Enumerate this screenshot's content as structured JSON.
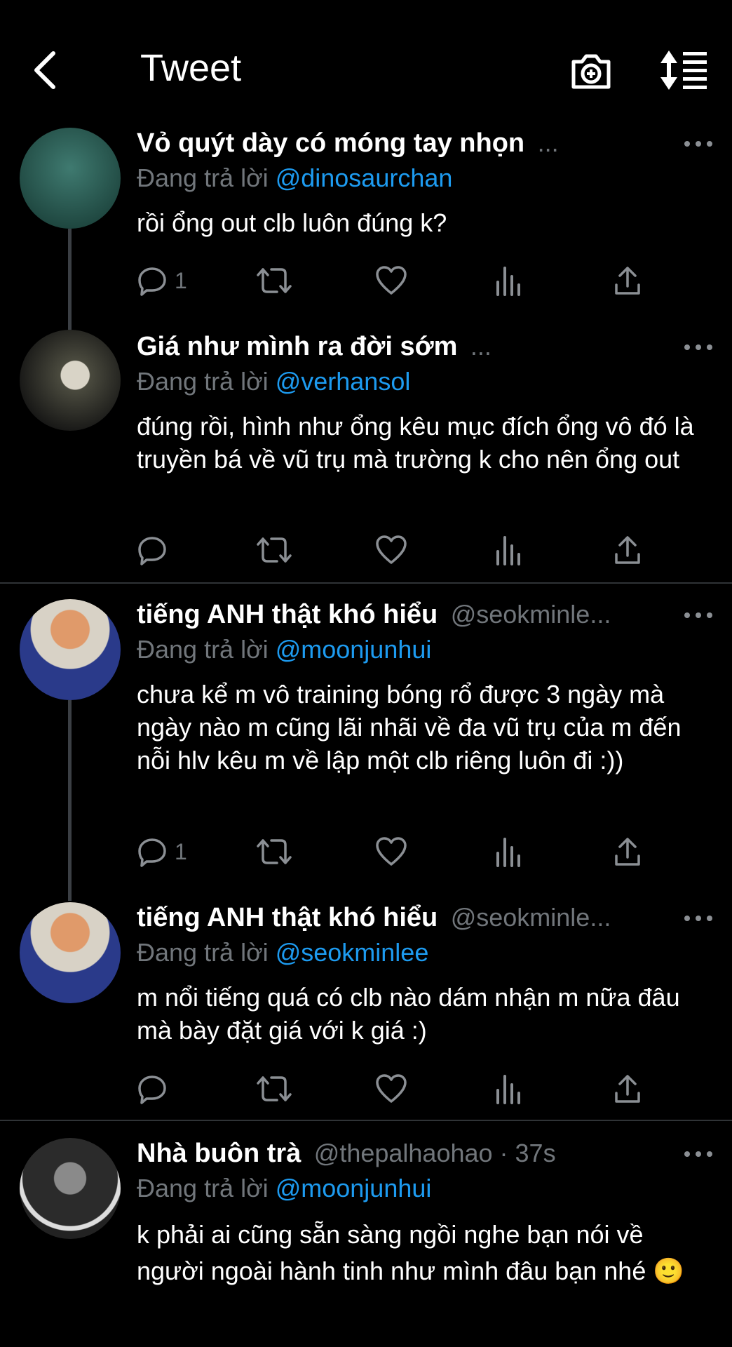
{
  "header": {
    "title": "Tweet",
    "icons": [
      "back-arrow-icon",
      "camera-plus-icon",
      "sort-list-icon"
    ]
  },
  "reply_prefix": "Đang trả lời",
  "tweets": [
    {
      "name": "Vỏ quýt dày có móng tay nhọn",
      "handle": "...",
      "reply_to": "@dinosaurchan",
      "text": "rồi ổng out clb luôn đúng k?",
      "reply_count": "1",
      "avatar_color": "#1f4a44"
    },
    {
      "name": "Giá như mình ra đời sớm",
      "handle": "...",
      "reply_to": "@verhansol",
      "text": "đúng rồi, hình như ổng kêu mục đích ổng vô đó là truyền bá về vũ trụ mà trường k cho nên ổng out",
      "reply_count": "",
      "avatar_color": "#2a2a2a"
    },
    {
      "name": "tiếng ANH thật khó hiểu",
      "handle": "@seokminle...",
      "reply_to": "@moonjunhui",
      "text": "chưa kể m vô training bóng rổ được 3 ngày mà ngày nào m cũng lãi nhãi về đa vũ trụ của m đến nỗi hlv kêu m về lập một clb riêng luôn đi :))",
      "reply_count": "1",
      "avatar_color": "#c97a4a"
    },
    {
      "name": "tiếng ANH thật khó hiểu",
      "handle": "@seokminle...",
      "reply_to": "@seokminlee",
      "text": "m nổi tiếng quá có clb nào dám nhận m nữa đâu mà bày đặt giá với k giá :)",
      "reply_count": "",
      "avatar_color": "#c97a4a"
    },
    {
      "name": "Nhà buôn trà",
      "handle": "@thepalhaohao · 37s",
      "reply_to": "@moonjunhui",
      "text": "k phải ai cũng sẵn sàng ngồi nghe bạn nói về người ngoài hành tinh như mình đâu bạn nhé 🙂",
      "reply_count": "",
      "avatar_color": "#3a3a3a"
    }
  ],
  "colors": {
    "background": "#000000",
    "link": "#1d9bf0",
    "muted": "#71767b",
    "divider": "#2f3336"
  }
}
